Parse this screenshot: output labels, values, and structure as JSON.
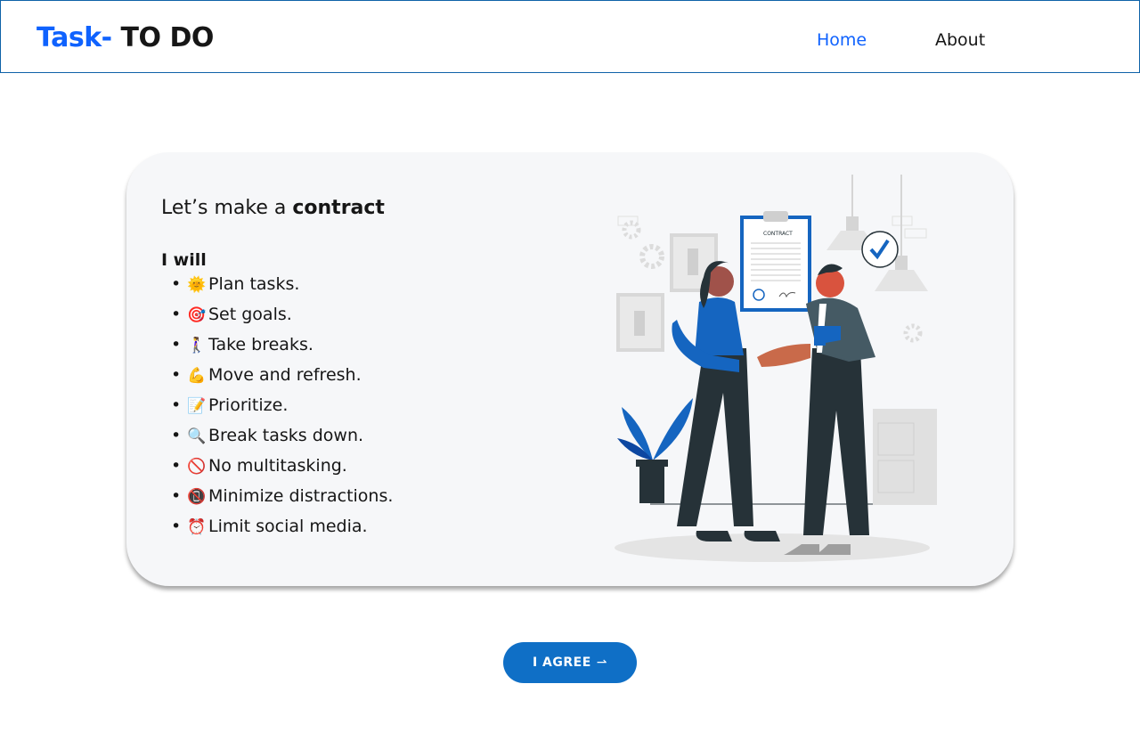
{
  "header": {
    "brand_accent": "Task-",
    "brand_rest": " TO DO",
    "nav": [
      {
        "label": "Home",
        "active": true
      },
      {
        "label": "About",
        "active": false
      }
    ]
  },
  "contract": {
    "title_prefix": "Let’s make a ",
    "title_bold": "contract",
    "list_heading": "I will",
    "items": [
      {
        "emoji": "🌞",
        "text": "Plan tasks."
      },
      {
        "emoji": "🎯",
        "text": "Set goals."
      },
      {
        "emoji": "🚶‍♀️",
        "text": "Take breaks."
      },
      {
        "emoji": "💪",
        "text": "Move and refresh."
      },
      {
        "emoji": "📝",
        "text": "Prioritize."
      },
      {
        "emoji": "🔍",
        "text": "Break tasks down."
      },
      {
        "emoji": "🚫",
        "text": "No multitasking."
      },
      {
        "emoji": "📵",
        "text": "Minimize distractions."
      },
      {
        "emoji": "⏰",
        "text": "Limit social media."
      }
    ],
    "illustration": {
      "document_label": "CONTRACT",
      "icon": "handshake-illustration"
    }
  },
  "agree_button": {
    "label": "I AGREE",
    "icon": "arrow-right-icon"
  },
  "colors": {
    "accent": "#0f62fe",
    "button": "#0f6fc6",
    "card": "#f6f7f9",
    "header_border": "#0f62a8"
  }
}
